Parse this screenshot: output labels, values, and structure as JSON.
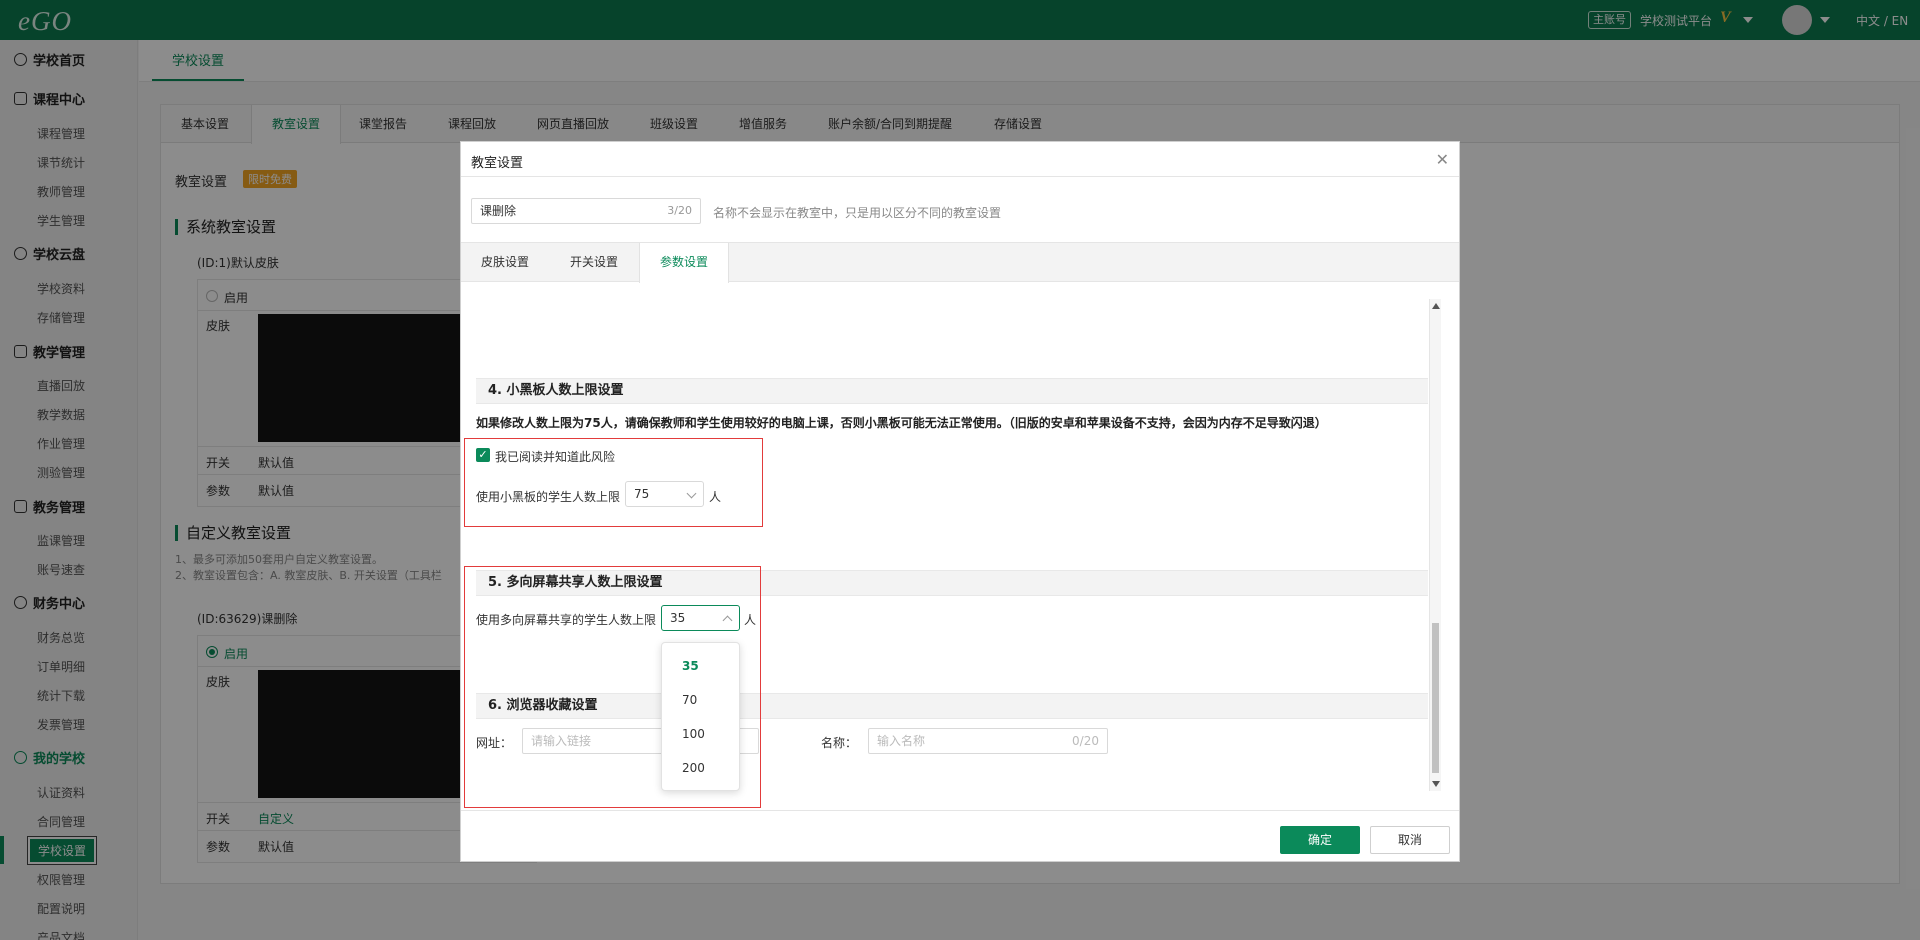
{
  "app": {
    "logo": "eGO"
  },
  "topbar": {
    "account_badge": "主账号",
    "account_name": "学校测试平台",
    "vip_mark": "V",
    "language": "中文 / EN"
  },
  "sidebar": {
    "sections": [
      {
        "label": "学校首页",
        "icon": "home-icon"
      },
      {
        "label": "课程中心",
        "icon": "calendar-icon",
        "items": [
          "课程管理",
          "课节统计",
          "教师管理",
          "学生管理"
        ]
      },
      {
        "label": "学校云盘",
        "icon": "cloud-icon",
        "items": [
          "学校资料",
          "存储管理"
        ]
      },
      {
        "label": "教学管理",
        "icon": "board-icon",
        "items": [
          "直播回放",
          "教学数据",
          "作业管理",
          "测验管理"
        ]
      },
      {
        "label": "教务管理",
        "icon": "grid-icon",
        "items": [
          "监课管理",
          "账号速查"
        ]
      },
      {
        "label": "财务中心",
        "icon": "coin-icon",
        "items": [
          "财务总览",
          "订单明细",
          "统计下载",
          "发票管理"
        ]
      },
      {
        "label": "我的学校",
        "icon": "school-icon",
        "items": [
          "认证资料",
          "合同管理",
          "学校设置",
          "权限管理",
          "配置说明",
          "产品文档"
        ]
      }
    ],
    "active_item": "学校设置"
  },
  "main": {
    "tab": "学校设置",
    "sub_tabs": [
      "基本设置",
      "教室设置",
      "课堂报告",
      "课程回放",
      "网页直播回放",
      "班级设置",
      "增值服务",
      "账户余额/合同到期提醒",
      "存储设置"
    ],
    "active_sub_tab": "教室设置",
    "classroom_label": "教室设置",
    "free_badge": "限时免费",
    "system_heading": "系统教室设置",
    "system_id": "(ID:1)默认皮肤",
    "enable_label": "启用",
    "skin_label": "皮肤",
    "switch_label": "开关",
    "param_label": "参数",
    "default_value": "默认值",
    "custom_heading": "自定义教室设置",
    "custom_note_1": "1、最多可添加50套用户自定义教室设置。",
    "custom_note_2": "2、教室设置包含：A. 教室皮肤、B. 开关设置（工具栏",
    "custom_id": "(ID:63629)课删除",
    "custom_switch_value": "自定义"
  },
  "modal": {
    "title": "教室设置",
    "name_value": "课删除",
    "name_count": "3/20",
    "name_hint": "名称不会显示在教室中，只是用以区分不同的教室设置",
    "tabs": [
      "皮肤设置",
      "开关设置",
      "参数设置"
    ],
    "active_tab": "参数设置",
    "section4": {
      "title": "4. 小黑板人数上限设置",
      "warning": "如果修改人数上限为75人，请确保教师和学生使用较好的电脑上课，否则小黑板可能无法正常使用。（旧版的安卓和苹果设备不支持，会因为内存不足导致闪退）",
      "checkbox_label": "我已阅读并知道此风险",
      "checked": true,
      "limit_label": "使用小黑板的学生人数上限",
      "limit_value": "75",
      "unit": "人"
    },
    "section5": {
      "title": "5. 多向屏幕共享人数上限设置",
      "limit_label": "使用多向屏幕共享的学生人数上限",
      "limit_value": "35",
      "unit": "人",
      "options": [
        "35",
        "70",
        "100",
        "200"
      ],
      "selected_option": "35"
    },
    "section6": {
      "title": "6. 浏览器收藏设置",
      "url_label": "网址：",
      "url_placeholder": "请输入链接",
      "name_label": "名称：",
      "name_placeholder": "输入名称",
      "name_count": "0/20"
    },
    "confirm": "确定",
    "cancel": "取消"
  },
  "colors": {
    "brand": "#0b7a4f",
    "accent": "#0b8a5a",
    "danger": "#e23b3b",
    "badge": "#f5a623"
  }
}
